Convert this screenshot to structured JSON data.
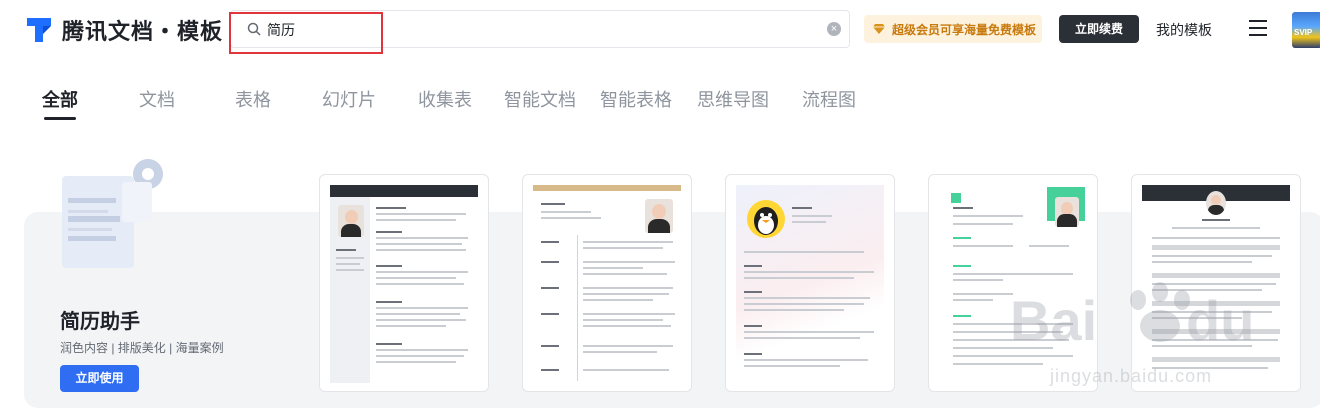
{
  "header": {
    "logo_text": "腾讯文档・模板",
    "search_value": "简历",
    "vip_text": "超级会员可享海量免费模板",
    "renew_label": "立即续费",
    "my_templates_label": "我的模板",
    "avatar_label": "SVIP"
  },
  "tabs": [
    "全部",
    "文档",
    "表格",
    "幻灯片",
    "收集表",
    "智能文档",
    "智能表格",
    "思维导图",
    "流程图"
  ],
  "active_tab": "全部",
  "assistant": {
    "title": "简历助手",
    "subtitle": "润色内容 | 排版美化 | 海量案例",
    "button_label": "立即使用"
  },
  "cards": [
    {
      "name": "resume-template-1",
      "style": "dark-sidebar"
    },
    {
      "name": "resume-template-2",
      "style": "gold-header"
    },
    {
      "name": "resume-template-3",
      "style": "penguin-avatar"
    },
    {
      "name": "resume-template-4",
      "style": "green-accent"
    },
    {
      "name": "resume-template-5",
      "style": "dark-header-centered"
    }
  ],
  "watermark": {
    "text": "jingyan.baidu.com"
  },
  "colors": {
    "primary": "#2f6ef3",
    "highlight": "#e0353a",
    "vip_text": "#c97a0e",
    "vip_bg": "#fdf2dd",
    "dark_button": "#2b2f36"
  }
}
